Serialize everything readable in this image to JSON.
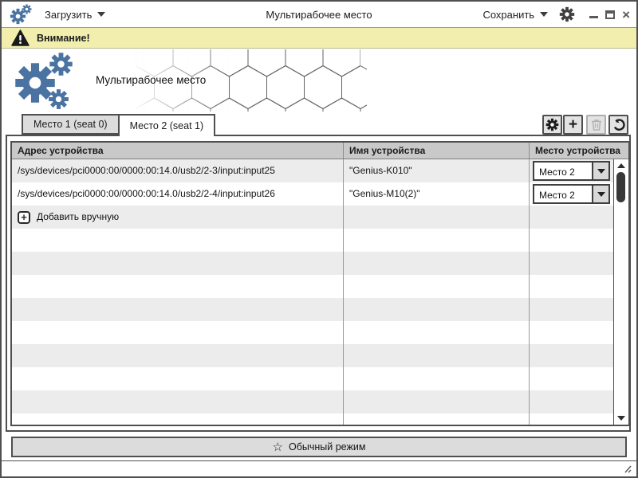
{
  "titlebar": {
    "title": "Мультирабочее место",
    "load_label": "Загрузить",
    "save_label": "Сохранить"
  },
  "banner": {
    "text": "Внимание!"
  },
  "header": {
    "app_title": "Мультирабочее место"
  },
  "tabs": [
    {
      "label": "Место 1 (seat 0)",
      "active": false
    },
    {
      "label": "Место 2 (seat 1)",
      "active": true
    }
  ],
  "toolbar": {
    "buttons": [
      "settings",
      "add",
      "delete",
      "reset"
    ],
    "delete_disabled": true
  },
  "table": {
    "columns": [
      "Адрес устройства",
      "Имя устройства",
      "Место устройства"
    ],
    "rows": [
      {
        "address": "/sys/devices/pci0000:00/0000:00:14.0/usb2/2-3/input:input25",
        "name": "\"Genius-K010\"",
        "seat": "Место 2"
      },
      {
        "address": "/sys/devices/pci0000:00/0000:00:14.0/usb2/2-4/input:input26",
        "name": "\"Genius-M10(2)\"",
        "seat": "Место 2"
      }
    ],
    "add_row_label": "Добавить вручную",
    "empty_row_count": 9
  },
  "footer": {
    "mode_button_label": "Обычный режим"
  },
  "colors": {
    "accent_blue": "#4b73a2",
    "banner_yellow": "#f2efae",
    "header_gray": "#c9c9c9",
    "alt_row_gray": "#ececec",
    "border_dark": "#4f4f4f"
  }
}
